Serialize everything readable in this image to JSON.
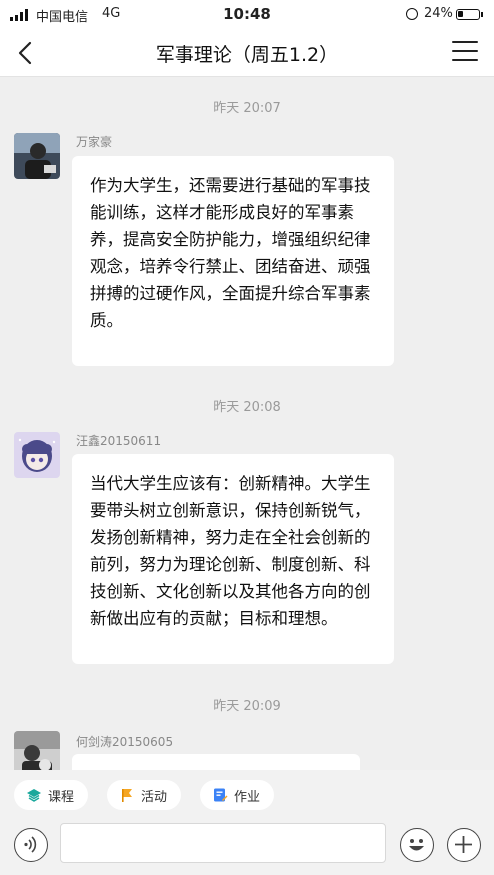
{
  "status_bar": {
    "carrier": "中国电信",
    "network": "4G",
    "time": "10:48",
    "battery": "24%",
    "battery_level": 0.24
  },
  "nav": {
    "title": "军事理论（周五1.2）",
    "back_icon": "chevron-left-icon",
    "menu_icon": "hamburger-menu-icon"
  },
  "messages": [
    {
      "timestamp": "昨天 20:07",
      "sender": "万家豪",
      "text": "作为大学生，还需要进行基础的军事技能训练，这样才能形成良好的军事素养，提高安全防护能力，增强组织纪律观念，培养令行禁止、团结奋进、顽强拼搏的过硬作风，全面提升综合军事素质。"
    },
    {
      "timestamp": "昨天 20:08",
      "sender": "汪鑫20150611",
      "text": "当代大学生应该有：创新精神。大学生要带头树立创新意识，保持创新锐气，发扬创新精神，努力走在全社会创新的前列，努力为理论创新、制度创新、科技创新、文化创新以及其他各方向的创新做出应有的贡献；目标和理想。"
    },
    {
      "timestamp": "昨天 20:09",
      "sender": "何剑涛20150605",
      "text": ""
    }
  ],
  "quick_actions": [
    {
      "label": "课程",
      "icon": "course-icon",
      "color": "#1aa89c"
    },
    {
      "label": "活动",
      "icon": "activity-flag-icon",
      "color": "#f5a623"
    },
    {
      "label": "作业",
      "icon": "homework-icon",
      "color": "#3b82f6"
    }
  ],
  "input": {
    "voice_icon": "voice-icon",
    "emoji_icon": "emoji-icon",
    "add_icon": "plus-icon",
    "placeholder": ""
  }
}
